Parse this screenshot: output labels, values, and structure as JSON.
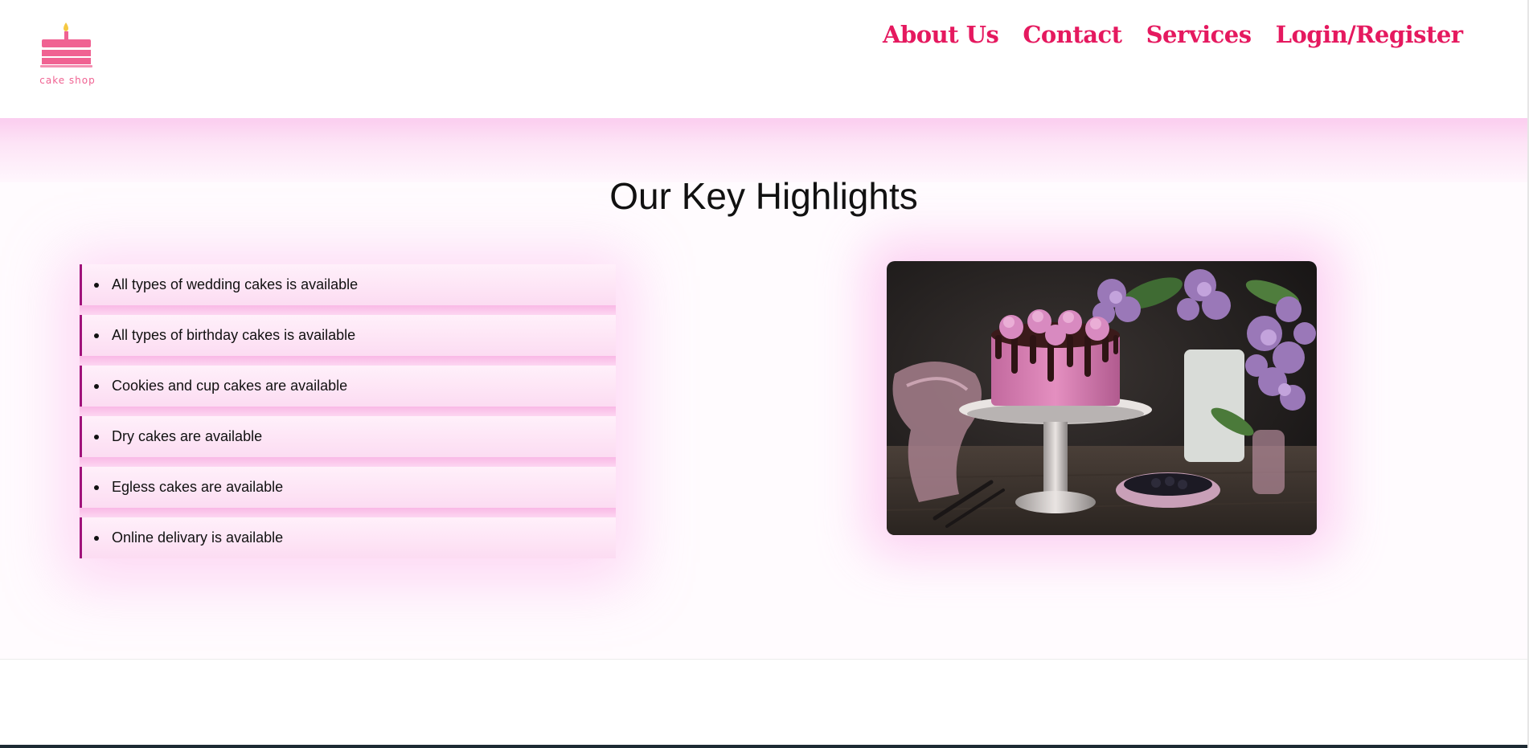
{
  "brand": {
    "logo_text": "cake shop",
    "accent_color": "#e5195f",
    "logo_color": "#f06292",
    "logo_icon": "cake-icon"
  },
  "nav": {
    "items": [
      {
        "label": "About Us"
      },
      {
        "label": "Contact"
      },
      {
        "label": "Services"
      },
      {
        "label": "Login/Register"
      }
    ]
  },
  "highlights": {
    "title": "Our Key Highlights",
    "items": [
      {
        "text": "All types of wedding cakes is available"
      },
      {
        "text": "All types of birthday cakes is available"
      },
      {
        "text": "Cookies and cup cakes are available"
      },
      {
        "text": "Dry cakes are available"
      },
      {
        "text": "Egless cakes are available"
      },
      {
        "text": "Online delivary is available"
      }
    ]
  },
  "image": {
    "subject": "pink frosted cake with chocolate drip on a stand beside lilac flowers"
  }
}
